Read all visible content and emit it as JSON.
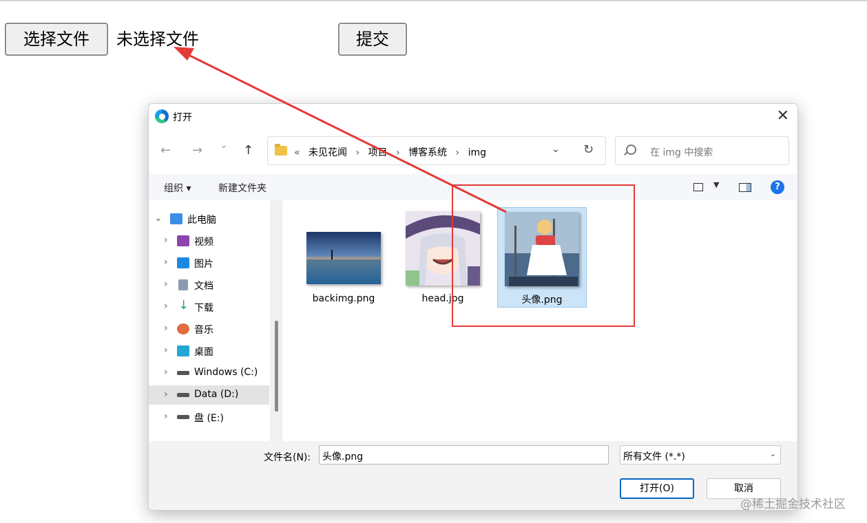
{
  "page": {
    "choose_file_label": "选择文件",
    "no_file_text": "未选择文件",
    "submit_label": "提交"
  },
  "dialog": {
    "title": "打开",
    "close_glyph": "✕",
    "nav": {
      "back": "←",
      "forward": "→",
      "recent": "⌄",
      "up": "↑"
    },
    "address": {
      "overflow": "«",
      "crumbs": [
        "未见花闻",
        "项目",
        "博客系统",
        "img"
      ],
      "separator": "›"
    },
    "refresh_glyph": "↻",
    "search_placeholder": "在 img 中搜索",
    "toolbar": {
      "organize": "组织 ▾",
      "new_folder": "新建文件夹",
      "help": "?"
    },
    "nav_pane": [
      {
        "label": "此电脑",
        "expanded": true,
        "icon": "monitor-icon",
        "color": "#3a8ee6"
      },
      {
        "label": "视频",
        "icon": "video-icon",
        "color": "#8e44ad"
      },
      {
        "label": "图片",
        "icon": "picture-icon",
        "color": "#1e88e5"
      },
      {
        "label": "文档",
        "icon": "document-icon",
        "color": "#8a9bb0"
      },
      {
        "label": "下载",
        "icon": "download-icon",
        "color": "#2a9d8f"
      },
      {
        "label": "音乐",
        "icon": "music-icon",
        "color": "#e26d3d"
      },
      {
        "label": "桌面",
        "icon": "desktop-icon",
        "color": "#23a6d5"
      },
      {
        "label": "Windows (C:)",
        "icon": "drive-icon",
        "color": "#555555"
      },
      {
        "label": "Data (D:)",
        "icon": "drive-icon",
        "color": "#555555",
        "selected": true
      },
      {
        "label": "盘 (E:)",
        "icon": "drive-icon",
        "color": "#555555"
      }
    ],
    "files": [
      {
        "name": "backimg.png",
        "selected": false
      },
      {
        "name": "head.jpg",
        "selected": false
      },
      {
        "name": "头像.png",
        "selected": true
      }
    ],
    "footer": {
      "filename_label": "文件名(N):",
      "filename_value": "头像.png",
      "filetype_value": "所有文件 (*.*)",
      "open_label": "打开(O)",
      "cancel_label": "取消"
    }
  },
  "watermark": "@稀土掘金技术社区",
  "colors": {
    "annotation_red": "#e53935",
    "accent_blue": "#0067c0",
    "selection_blue": "#cce4f7"
  }
}
